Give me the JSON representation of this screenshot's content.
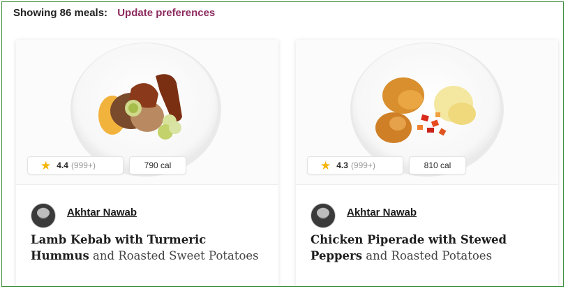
{
  "header": {
    "count_label": "Showing 86 meals:",
    "update_link": "Update preferences"
  },
  "colors": {
    "link": "#8c2a5e",
    "star": "#f5b400",
    "frame_border": "#3e8e3e"
  },
  "meals": [
    {
      "image": "lamb-kebab-plate",
      "rating": "4.4",
      "reviews": "(999+)",
      "calories": "790 cal",
      "chef": "Akhtar Nawab",
      "title_bold": "Lamb Kebab with Turmeric Hummus",
      "title_rest": " and Roasted Sweet Potatoes"
    },
    {
      "image": "chicken-piperade-plate",
      "rating": "4.3",
      "reviews": "(999+)",
      "calories": "810 cal",
      "chef": "Akhtar Nawab",
      "title_bold": "Chicken Piperade with Stewed Peppers",
      "title_rest": " and Roasted Potatoes"
    }
  ]
}
